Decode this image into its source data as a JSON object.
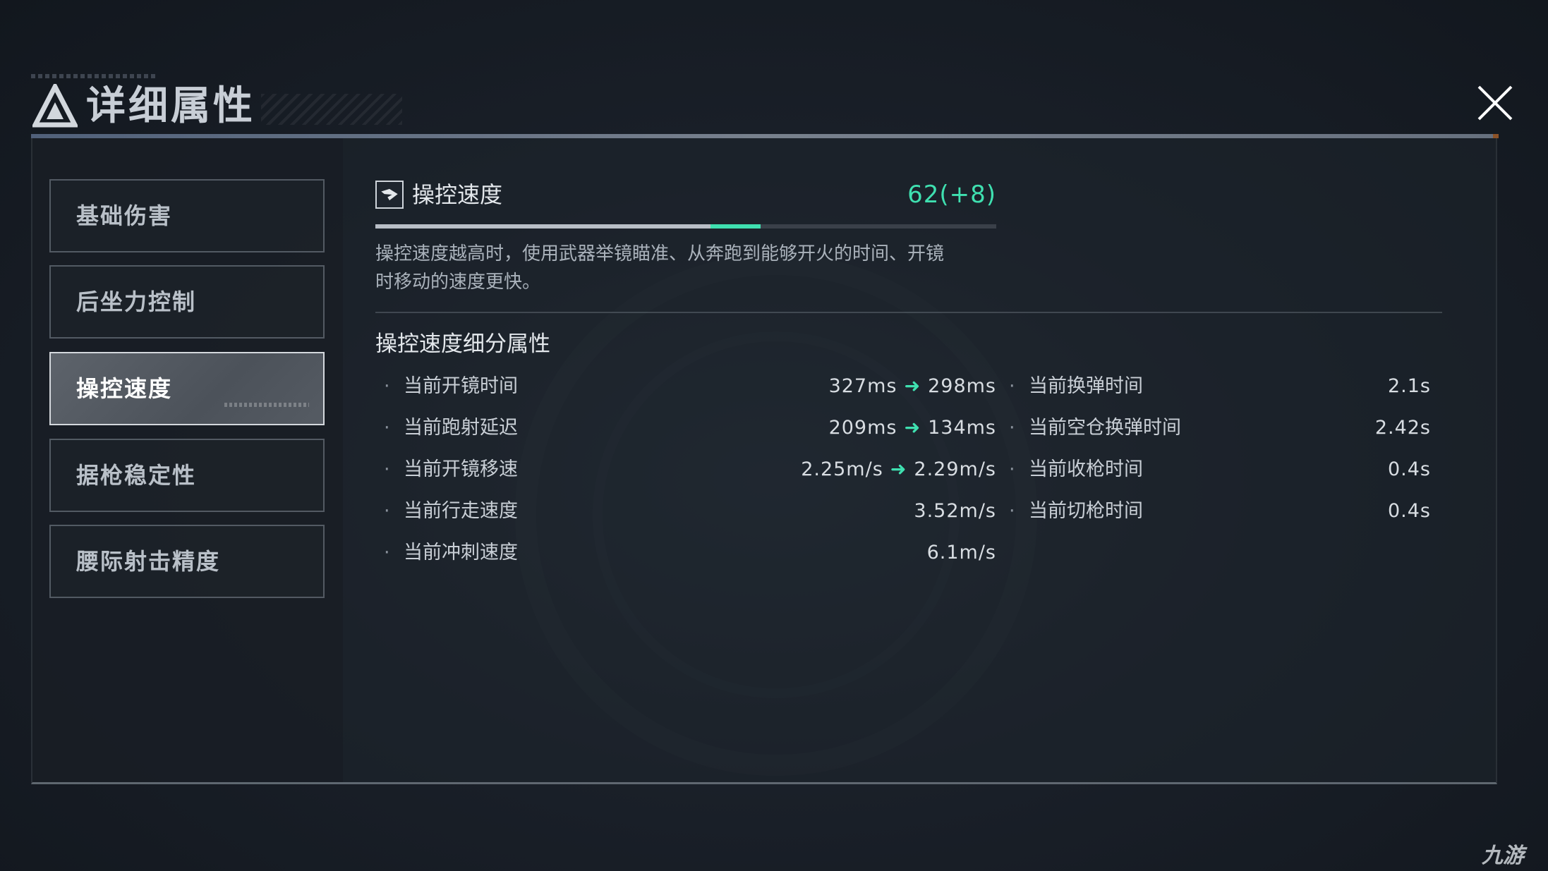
{
  "header": {
    "title": "详细属性",
    "close_icon": "close-icon"
  },
  "sidebar": {
    "items": [
      {
        "label": "基础伤害",
        "active": false
      },
      {
        "label": "后坐力控制",
        "active": false
      },
      {
        "label": "操控速度",
        "active": true
      },
      {
        "label": "据枪稳定性",
        "active": false
      },
      {
        "label": "腰际射击精度",
        "active": false
      }
    ]
  },
  "stat": {
    "icon": "handling-icon",
    "name": "操控速度",
    "value": "62(+8)",
    "bar": {
      "base_fraction": 0.54,
      "bonus_fraction": 0.08,
      "base_color": "#b8bec6",
      "bonus_color": "#3fe0b0"
    },
    "description_line1": "操控速度越高时，使用武器举镜瞄准、从奔跑到能够开火的时间、开镜",
    "description_line2": "时移动的速度更快。"
  },
  "breakdown": {
    "title": "操控速度细分属性",
    "left": [
      {
        "label": "当前开镜时间",
        "from": "327ms",
        "to": "298ms"
      },
      {
        "label": "当前跑射延迟",
        "from": "209ms",
        "to": "134ms"
      },
      {
        "label": "当前开镜移速",
        "from": "2.25m/s",
        "to": "2.29m/s"
      },
      {
        "label": "当前行走速度",
        "value": "3.52m/s"
      },
      {
        "label": "当前冲刺速度",
        "value": "6.1m/s"
      }
    ],
    "right": [
      {
        "label": "当前换弹时间",
        "value": "2.1s"
      },
      {
        "label": "当前空仓换弹时间",
        "value": "2.42s"
      },
      {
        "label": "当前收枪时间",
        "value": "0.4s"
      },
      {
        "label": "当前切枪时间",
        "value": "0.4s"
      }
    ],
    "bullet": "·",
    "arrow": "➜"
  },
  "colors": {
    "accent": "#3fe0b0",
    "background": "#161c24"
  },
  "watermark": "九游"
}
